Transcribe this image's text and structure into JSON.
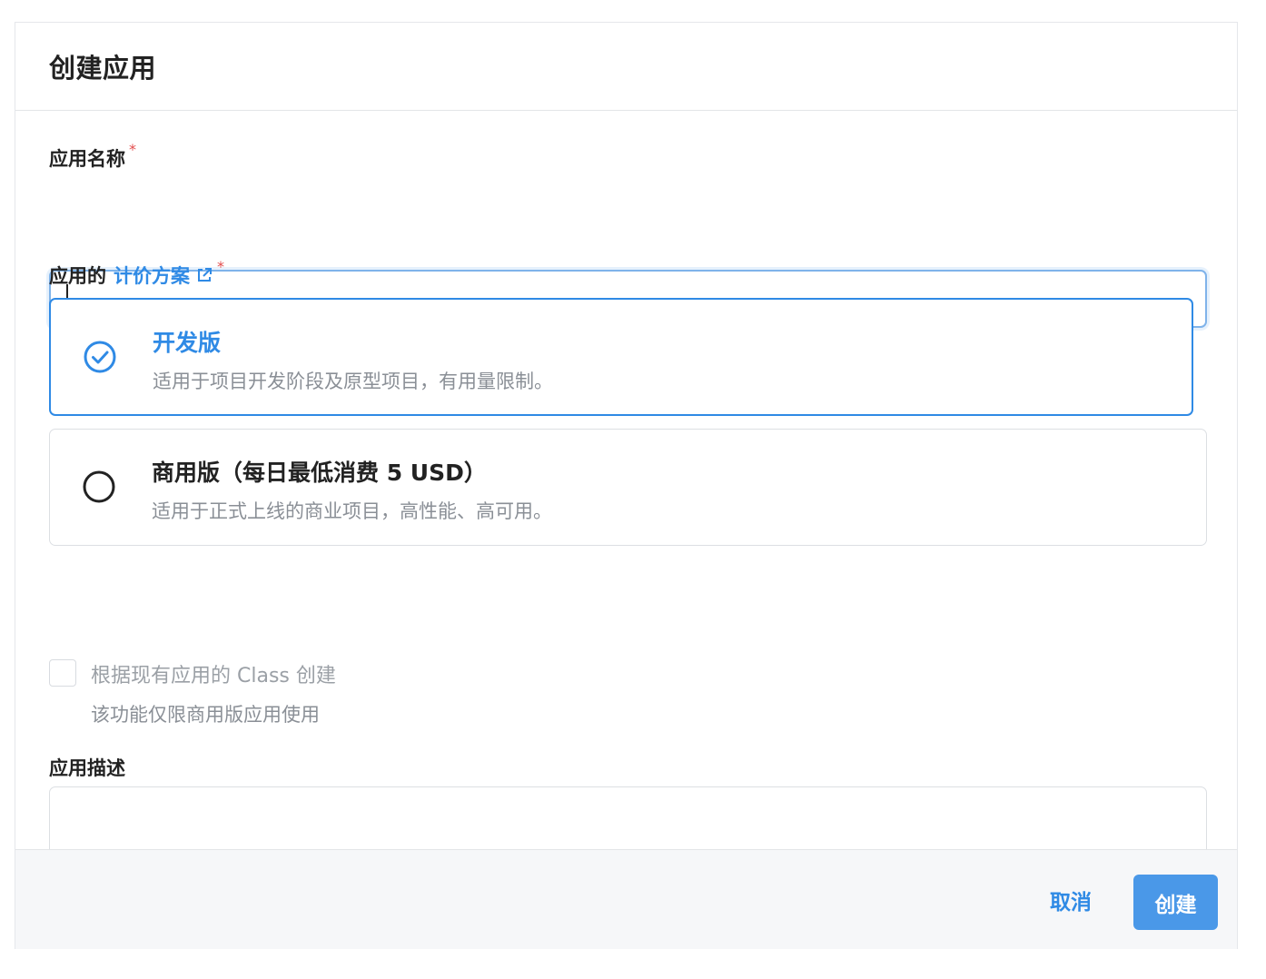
{
  "dialog": {
    "title": "创建应用"
  },
  "form": {
    "name_label": "应用名称",
    "name_required": "*",
    "name_value": "",
    "plan_label_prefix": "应用的",
    "plan_link_text": "计价方案",
    "plan_required": "*",
    "plans": [
      {
        "title": "开发版",
        "description": "适用于项目开发阶段及原型项目，有用量限制。",
        "selected": true
      },
      {
        "title": "商用版（每日最低消费 5 USD）",
        "description": "适用于正式上线的商业项目，高性能、高可用。",
        "selected": false
      }
    ],
    "class_checkbox_label": "根据现有应用的 Class 创建",
    "class_checkbox_hint": "该功能仅限商用版应用使用",
    "class_checkbox_checked": false,
    "description_label": "应用描述",
    "description_value": ""
  },
  "footer": {
    "cancel_label": "取消",
    "create_label": "创建"
  },
  "colors": {
    "accent": "#2f8ae5",
    "required": "#e34d4d",
    "primary_button": "#4a98e8"
  }
}
